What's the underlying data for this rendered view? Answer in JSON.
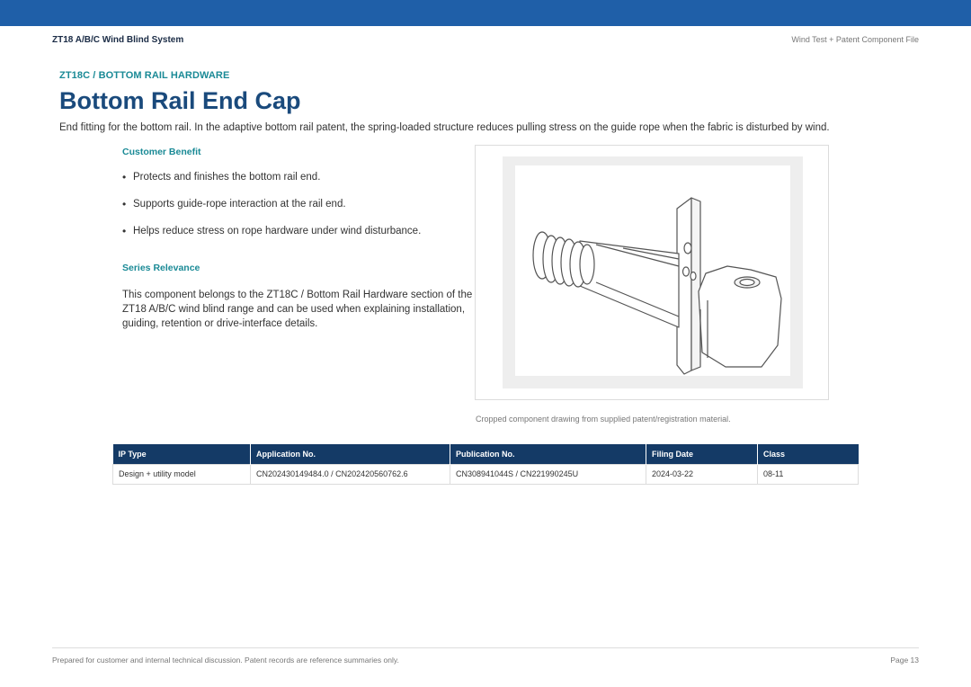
{
  "header": {
    "left_title": "ZT18 A/B/C Wind Blind System",
    "right_title": "Wind Test + Patent Component File"
  },
  "section": {
    "kicker": "ZT18C / BOTTOM RAIL HARDWARE",
    "title": "Bottom Rail End Cap",
    "intro": "End fitting for the bottom rail. In the adaptive bottom rail patent, the spring-loaded structure reduces pulling stress on the guide rope when the fabric is disturbed by wind."
  },
  "benefit": {
    "heading": "Customer Benefit",
    "items": [
      "Protects and finishes the bottom rail end.",
      "Supports guide-rope interaction at the rail end.",
      "Helps reduce stress on rope hardware under wind disturbance."
    ]
  },
  "series": {
    "heading": "Series Relevance",
    "text": "This component belongs to the ZT18C / Bottom Rail Hardware section of the ZT18 A/B/C wind blind range and can be used when explaining installation, guiding, retention or drive-interface details."
  },
  "figure": {
    "caption": "Cropped component drawing from supplied patent/registration material."
  },
  "ip_table": {
    "headers": [
      "IP Type",
      "Application No.",
      "Publication No.",
      "Filing Date",
      "Class"
    ],
    "rows": [
      [
        "Design + utility model",
        "CN202430149484.0 / CN202420560762.6",
        "CN308941044S / CN221990245U",
        "2024-03-22",
        "08-11"
      ]
    ]
  },
  "footer": {
    "note": "Prepared for customer and internal technical discussion. Patent records are reference summaries only.",
    "page": "Page 13"
  },
  "colors": {
    "topbar": "#1f5fa8",
    "accent_teal": "#1a8a96",
    "title_blue": "#1a4a7c",
    "table_header": "#143a66"
  }
}
